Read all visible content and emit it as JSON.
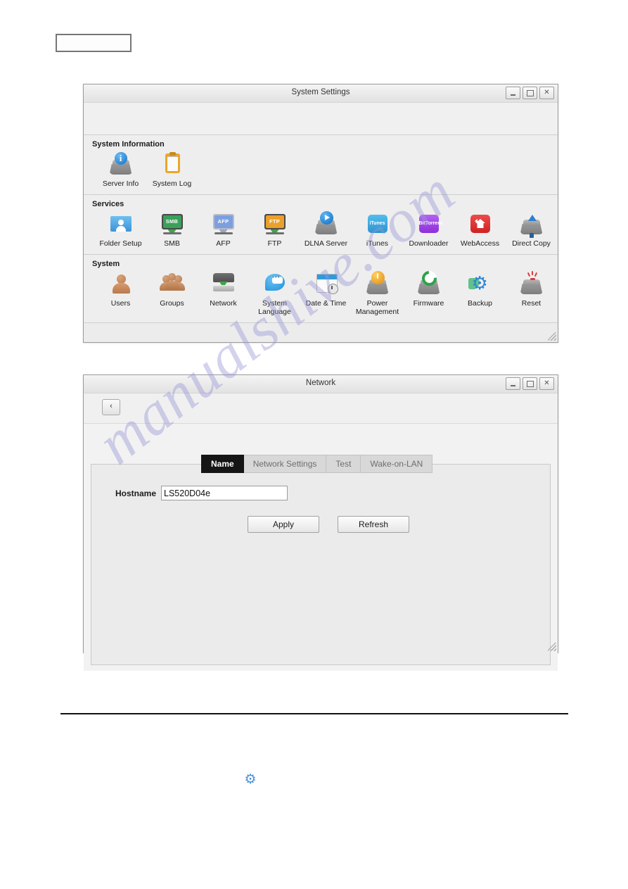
{
  "watermark": {
    "text": "manualshive.com"
  },
  "top_box": {
    "text": ""
  },
  "system_settings_window": {
    "title": "System Settings",
    "window_buttons": {
      "minimize": "minimize-icon",
      "maximize": "maximize-icon",
      "close": "✕"
    },
    "sections": [
      {
        "title": "System Information",
        "items": [
          {
            "label": "Server Info",
            "icon": "server-info-icon",
            "badge": "i"
          },
          {
            "label": "System Log",
            "icon": "system-log-icon"
          }
        ]
      },
      {
        "title": "Services",
        "items": [
          {
            "label": "Folder Setup",
            "icon": "folder-setup-icon"
          },
          {
            "label": "SMB",
            "icon": "smb-icon",
            "screen_text": "SMB",
            "screen_color": "#3aa05a"
          },
          {
            "label": "AFP",
            "icon": "afp-icon",
            "screen_text": "AFP",
            "screen_color": "#7c9fe0"
          },
          {
            "label": "FTP",
            "icon": "ftp-icon",
            "screen_text": "FTP",
            "screen_color": "#eaa02a"
          },
          {
            "label": "DLNA Server",
            "icon": "dlna-server-icon"
          },
          {
            "label": "iTunes",
            "icon": "itunes-icon",
            "tile_text": "iTunes",
            "tile_color": "#3aa8de"
          },
          {
            "label": "Downloader",
            "icon": "downloader-icon",
            "tile_text": "BitTorrent",
            "tile_color": "#a347e8"
          },
          {
            "label": "WebAccess",
            "icon": "webaccess-icon",
            "tile_color": "#e03434"
          },
          {
            "label": "Direct Copy",
            "icon": "direct-copy-icon"
          }
        ]
      },
      {
        "title": "System",
        "items": [
          {
            "label": "Users",
            "icon": "users-icon"
          },
          {
            "label": "Groups",
            "icon": "groups-icon"
          },
          {
            "label": "Network",
            "icon": "network-icon"
          },
          {
            "label": "System\nLanguage",
            "icon": "system-language-icon"
          },
          {
            "label": "Date & Time",
            "icon": "date-time-icon"
          },
          {
            "label": "Power\nManagement",
            "icon": "power-management-icon"
          },
          {
            "label": "Firmware",
            "icon": "firmware-icon"
          },
          {
            "label": "Backup",
            "icon": "backup-icon"
          },
          {
            "label": "Reset",
            "icon": "reset-icon"
          }
        ]
      }
    ]
  },
  "network_window": {
    "title": "Network",
    "back_button": "‹",
    "window_buttons": {
      "minimize": "minimize-icon",
      "maximize": "maximize-icon",
      "close": "✕"
    },
    "tabs": [
      {
        "label": "Name",
        "active": true
      },
      {
        "label": "Network Settings",
        "active": false
      },
      {
        "label": "Test",
        "active": false
      },
      {
        "label": "Wake-on-LAN",
        "active": false
      }
    ],
    "form": {
      "hostname_label": "Hostname",
      "hostname_value": "LS520D04e",
      "hostname_placeholder": "",
      "apply_label": "Apply",
      "refresh_label": "Refresh"
    }
  },
  "footer": {
    "gear_icon": "⚙"
  },
  "colors": {
    "tab_active_bg": "#151515",
    "accent_blue": "#2c86d6",
    "window_bg": "#ececec"
  }
}
